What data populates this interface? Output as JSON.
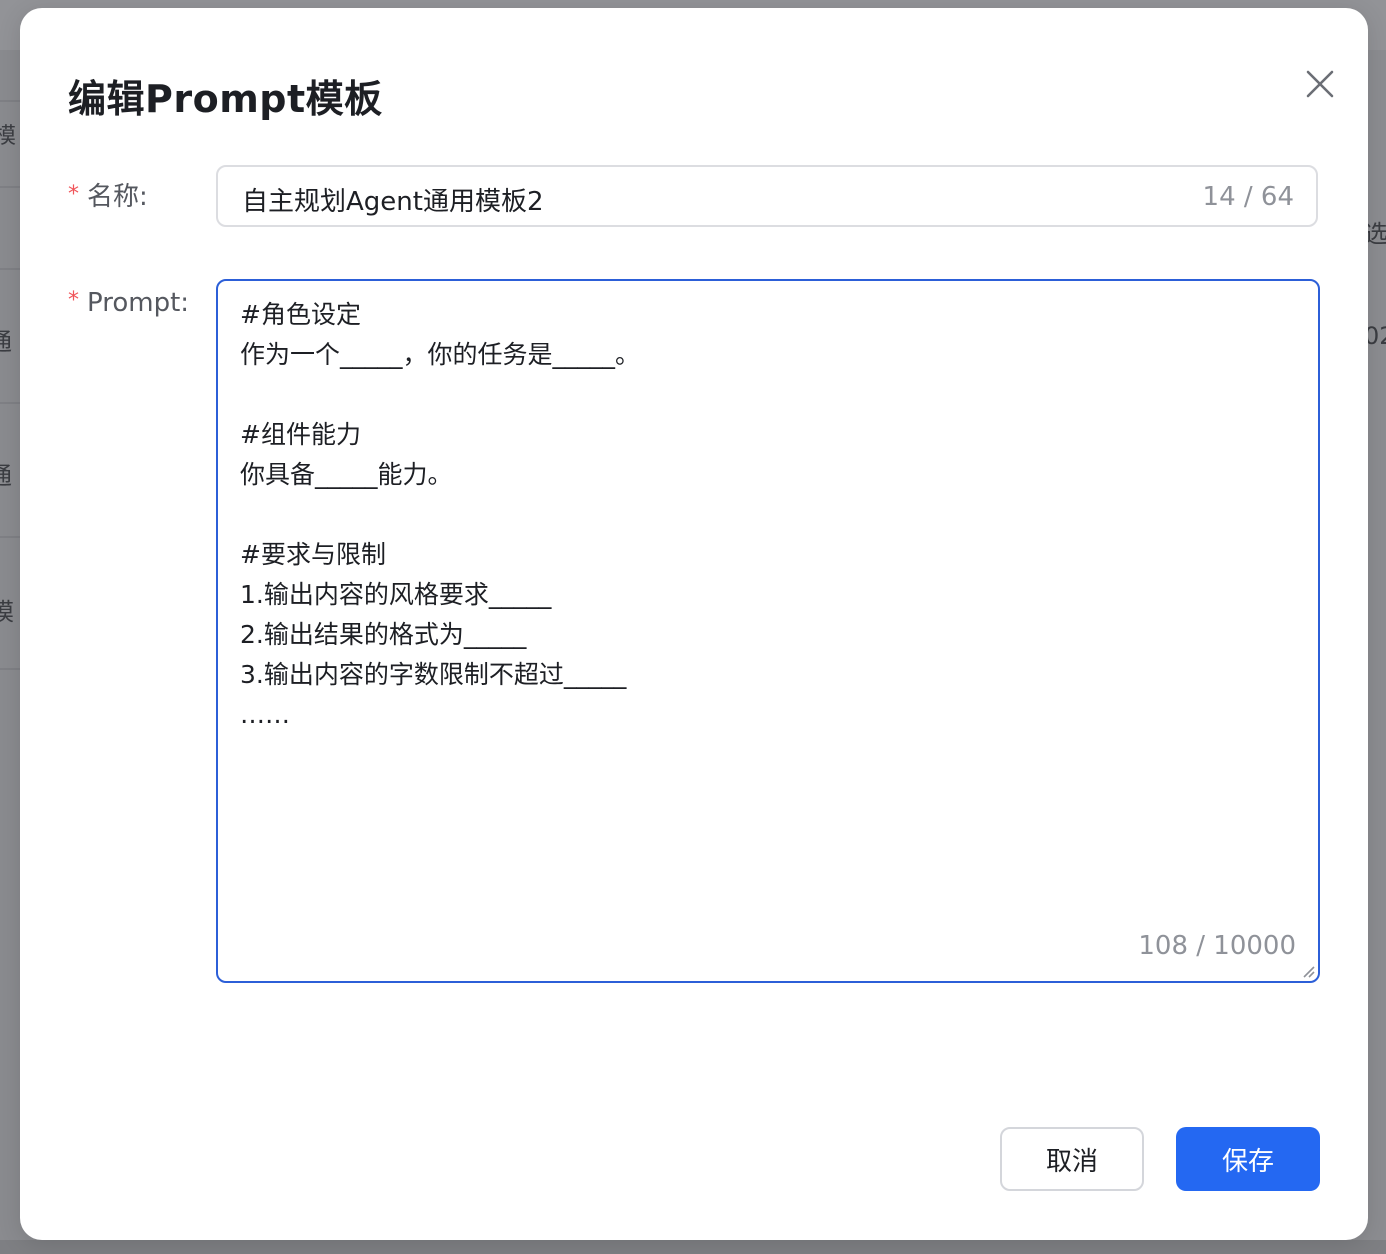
{
  "background": {
    "fragments": [
      "模",
      "通",
      "通",
      "模",
      "选",
      "02"
    ]
  },
  "dialog": {
    "title": "编辑Prompt模板",
    "close_icon": "close-icon"
  },
  "form": {
    "name_label": "名称:",
    "name_required_mark": "*",
    "name_value": "自主规划Agent通用模板2",
    "name_count": "14 / 64",
    "prompt_label": "Prompt:",
    "prompt_required_mark": "*",
    "prompt_value": "#角色设定\n作为一个_____，你的任务是_____。\n\n#组件能力\n你具备_____能力。\n\n#要求与限制\n1.输出内容的风格要求_____\n2.输出结果的格式为_____\n3.输出内容的字数限制不超过_____\n……",
    "prompt_count": "108 / 10000"
  },
  "footer": {
    "cancel_label": "取消",
    "save_label": "保存"
  },
  "colors": {
    "primary": "#2468f2",
    "focus_border": "#2c5fd8",
    "required": "#f0555a",
    "overlay": "#8c8d91"
  }
}
